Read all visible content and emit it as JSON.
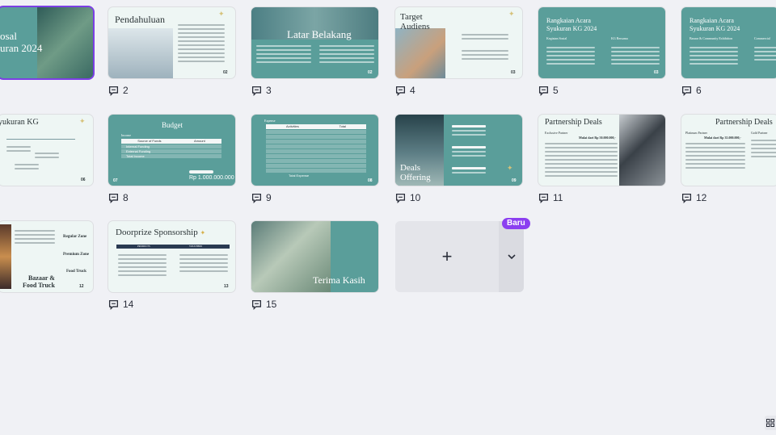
{
  "slides": [
    {
      "id": "s1",
      "number": "1",
      "title": "Proposal Syukuran 2024",
      "title_lines": [
        "osal",
        "uran 2024"
      ],
      "comments": ""
    },
    {
      "id": "s2",
      "number": "2",
      "title": "Pendahuluan",
      "page": "02",
      "comments": "2"
    },
    {
      "id": "s3",
      "number": "3",
      "title": "Latar Belakang",
      "page": "02",
      "comments": "3"
    },
    {
      "id": "s4",
      "number": "4",
      "title": "Target Audiens",
      "title_lines": [
        "Target",
        "Audiens"
      ],
      "page": "03",
      "comments": "4"
    },
    {
      "id": "s5",
      "number": "5",
      "title": "Rangkaian Acara Syukuran KG 2024",
      "title_lines": [
        "Rangkaian Acara",
        "Syukuran KG 2024"
      ],
      "sub_left": "Kegiatan Sosial",
      "sub_right": "KG Bersama",
      "page": "03",
      "comments": "5"
    },
    {
      "id": "s6",
      "number": "6",
      "title": "Rangkaian Acara Syukuran KG 2024",
      "title_lines": [
        "Rangkaian Acara",
        "Syukuran KG 2024"
      ],
      "sub_left": "Bazaar & Community Exhibition",
      "sub_right": "Commercial",
      "comments": "6"
    },
    {
      "id": "s7",
      "number": "7",
      "title": "Syukuran KG",
      "title_lines": [
        "yukuran KG"
      ],
      "page": "06",
      "comments": ""
    },
    {
      "id": "s8",
      "number": "8",
      "title": "Budget",
      "income_label": "Income",
      "col_a": "Source of Funds",
      "col_b": "Amount",
      "rows": [
        "Internal Funding",
        "External Funding",
        "Total Income"
      ],
      "total": "Rp 1.000.000.000",
      "page": "07",
      "comments": "8"
    },
    {
      "id": "s9",
      "number": "9",
      "title": "Expense",
      "col_a": "Activities",
      "col_b": "Total",
      "total_label": "Total Expense",
      "page": "08",
      "comments": "9"
    },
    {
      "id": "s10",
      "number": "10",
      "title": "Deals Offering",
      "title_lines": [
        "Deals",
        "Offering"
      ],
      "page": "09",
      "comments": "10"
    },
    {
      "id": "s11",
      "number": "11",
      "title": "Partnership Deals",
      "tier": "Exclusive Partner",
      "price": "Mulai dari Rp 50.000.000,-",
      "comments": "11"
    },
    {
      "id": "s12",
      "number": "12",
      "title": "Partnership Deals",
      "tier_a": "Platinum Partner",
      "tier_b": "Gold Partner",
      "price": "Mulai dari Rp 35.000.000,-",
      "comments": "12"
    },
    {
      "id": "s13",
      "number": "13",
      "zones": [
        "Regular Zone",
        "Premium Zone",
        "Food Truck"
      ],
      "title": "Bazaar & Food Truck",
      "title_lines": [
        "Bazaar &",
        "Food Truck"
      ],
      "page": "12",
      "comments": ""
    },
    {
      "id": "s14",
      "number": "14",
      "title": "Doorprize Sponsorship",
      "col_a": "PRODUCTS",
      "col_b": "VOUCHERS",
      "page": "13",
      "comments": "14"
    },
    {
      "id": "s15",
      "number": "15",
      "title": "Terima Kasih",
      "comments": "15"
    }
  ],
  "add_tile": {
    "plus": "+",
    "badge": "Baru"
  },
  "icons": {
    "comment": "comment-icon",
    "add": "plus-icon",
    "chevron": "chevron-down-icon",
    "grid": "grid-view-icon"
  },
  "colors": {
    "accent": "#7b3fe4",
    "teal": "#5a9e9a",
    "badge": "#8b3ff0"
  }
}
